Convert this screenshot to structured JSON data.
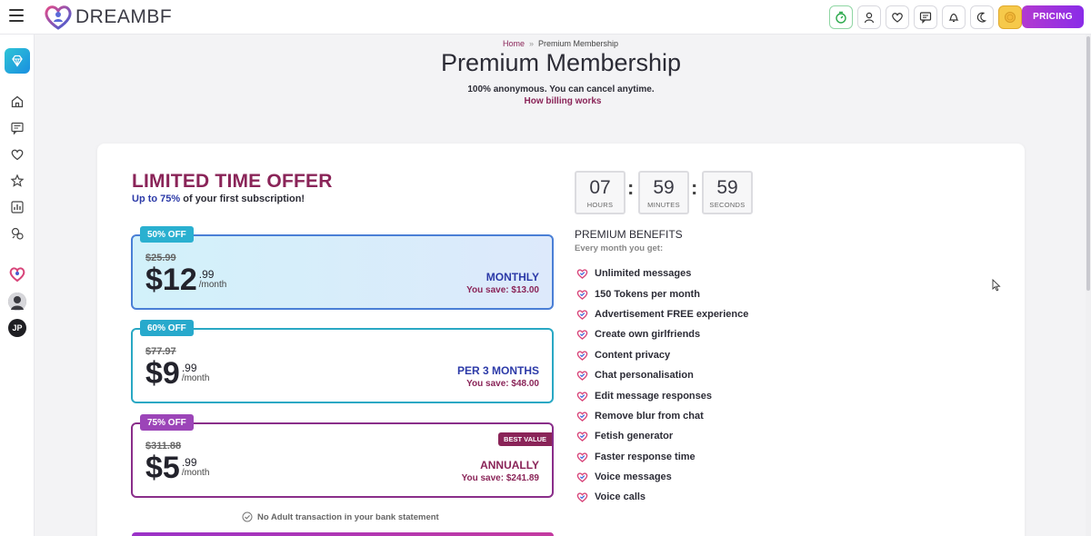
{
  "app": {
    "name": "DREAMBF"
  },
  "header": {
    "icons": [
      "timer-icon",
      "user-icon",
      "heart-icon",
      "chat-icon",
      "bell-icon",
      "moon-icon",
      "coin-icon"
    ],
    "pricing_label": "PRICING"
  },
  "sidebar": {
    "items": [
      "premium-diamond-icon",
      "home-icon",
      "chat-icon",
      "heart-icon",
      "star-icon",
      "gallery-icon",
      "generator-icon"
    ],
    "avatars": [
      "logo-avatar",
      "character-avatar",
      "JP"
    ]
  },
  "breadcrumb": {
    "home": "Home",
    "separator": "»",
    "current": "Premium Membership"
  },
  "page": {
    "title": "Premium Membership",
    "subtitle": "100% anonymous. You can cancel anytime.",
    "billing_link": "How billing works"
  },
  "offer": {
    "title": "LIMITED TIME OFFER",
    "sub_highlight": "Up to 75%",
    "sub_rest": "of your first subscription!"
  },
  "plans": [
    {
      "tag": "50% OFF",
      "old_price": "$25.99",
      "dollars": "$12",
      "cents": ".99",
      "per": "/month",
      "period": "MONTHLY",
      "save": "You save: $13.00"
    },
    {
      "tag": "60% OFF",
      "old_price": "$77.97",
      "dollars": "$9",
      "cents": ".99",
      "per": "/month",
      "period": "PER 3 MONTHS",
      "save": "You save: $48.00"
    },
    {
      "tag": "75% OFF",
      "old_price": "$311.88",
      "dollars": "$5",
      "cents": ".99",
      "per": "/month",
      "period": "ANNUALLY",
      "save": "You save: $241.89",
      "badge": "BEST VALUE"
    }
  ],
  "no_adult": "No Adult transaction in your bank statement",
  "countdown": {
    "hours": "07",
    "hours_label": "HOURS",
    "minutes": "59",
    "minutes_label": "MINUTES",
    "seconds": "59",
    "seconds_label": "SECONDS",
    "separator": ":"
  },
  "benefits": {
    "title": "PREMIUM BENEFITS",
    "subtitle": "Every month you get:",
    "items": [
      "Unlimited messages",
      "150 Tokens per month",
      "Advertisement FREE experience",
      "Create own girlfriends",
      "Content privacy",
      "Chat personalisation",
      "Edit message responses",
      "Remove blur from chat",
      "Fetish generator",
      "Faster response time",
      "Voice messages",
      "Voice calls"
    ]
  },
  "colors": {
    "brand": "#8a2458",
    "accent_blue": "#2c3aa8",
    "pricing_gradient": "#8a2be8"
  }
}
